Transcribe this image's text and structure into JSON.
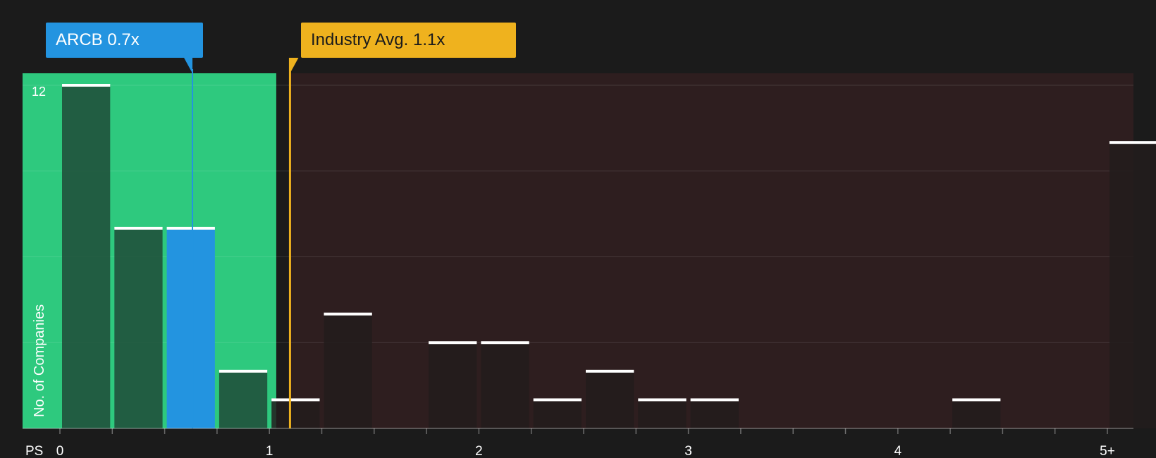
{
  "company_label": "ARCB 0.7x",
  "industry_label": "Industry Avg. 1.1x",
  "x_axis_label": "PS",
  "y_axis_label": "No. of Companies",
  "colors": {
    "background": "#1b1b1b",
    "undervalued_zone": "#2ec97e",
    "overvalued_zone": "#2e1e1f",
    "company": "#2394e0",
    "industry": "#efb21e",
    "bar_in_zone": "#1f4a37",
    "bar_out_zone": "#221c1c",
    "bar_cap": "#ffffff"
  },
  "chart_data": {
    "type": "bar",
    "title": "",
    "xlabel": "PS",
    "ylabel": "No. of Companies",
    "xlim": [
      0,
      5.1
    ],
    "ylim": [
      0,
      12
    ],
    "x_ticks": [
      {
        "value": 0,
        "label": "0"
      },
      {
        "value": 1,
        "label": "1"
      },
      {
        "value": 2,
        "label": "2"
      },
      {
        "value": 3,
        "label": "3"
      },
      {
        "value": 4,
        "label": "4"
      },
      {
        "value": 5,
        "label": "5+"
      }
    ],
    "y_ticks": [
      {
        "value": 12,
        "label": "12"
      }
    ],
    "bin_width": 0.25,
    "bins": [
      {
        "start": 0.0,
        "count": 12
      },
      {
        "start": 0.25,
        "count": 7
      },
      {
        "start": 0.5,
        "count": 7,
        "highlight": true
      },
      {
        "start": 0.75,
        "count": 2
      },
      {
        "start": 1.0,
        "count": 1
      },
      {
        "start": 1.25,
        "count": 4
      },
      {
        "start": 1.75,
        "count": 3
      },
      {
        "start": 2.0,
        "count": 3
      },
      {
        "start": 2.25,
        "count": 1
      },
      {
        "start": 2.5,
        "count": 2
      },
      {
        "start": 2.75,
        "count": 1
      },
      {
        "start": 3.0,
        "count": 1
      },
      {
        "start": 4.25,
        "count": 1
      },
      {
        "start": 5.0,
        "count": 10
      }
    ],
    "company": {
      "name": "ARCB",
      "value": 0.7
    },
    "industry_average": 1.1,
    "undervalued_zone_end": 1.1,
    "grid": true
  }
}
